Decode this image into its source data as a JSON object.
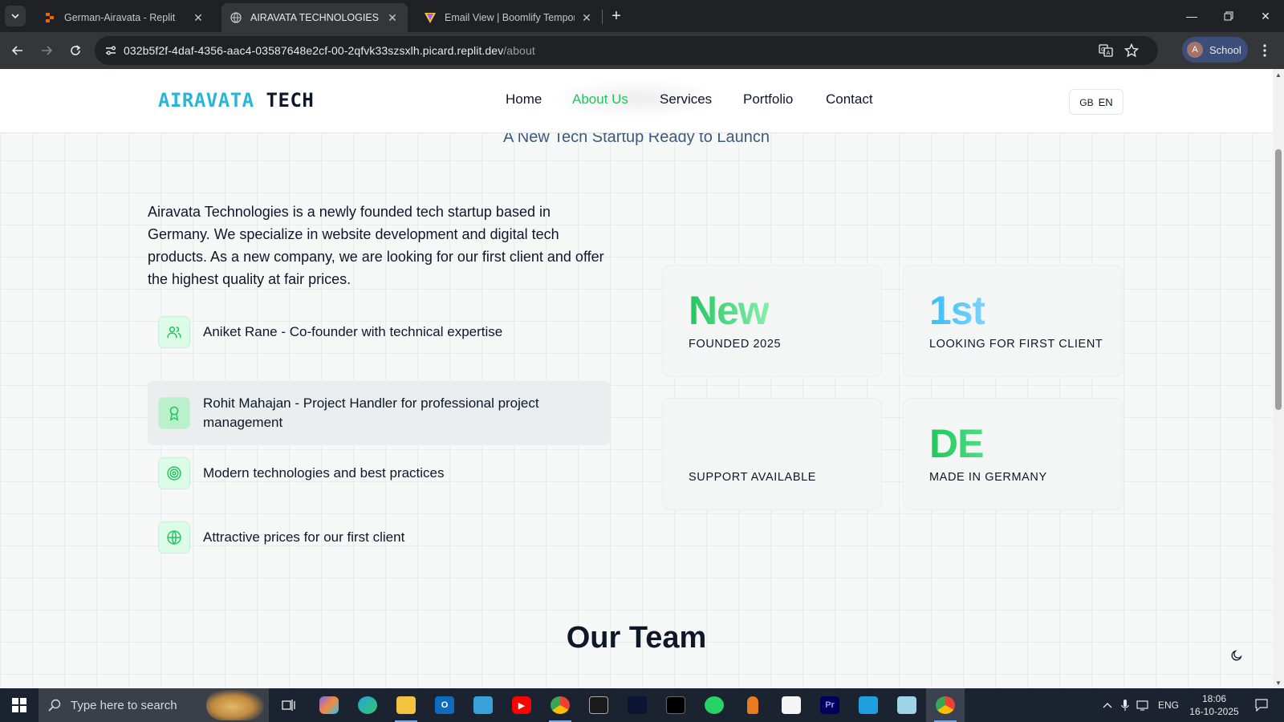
{
  "browser": {
    "tabs": [
      {
        "title": "German-Airavata - Replit",
        "favicon": "replit-icon"
      },
      {
        "title": "AIRAVATA TECHNOLOGIES - Cu",
        "favicon": "globe-icon"
      },
      {
        "title": "Email View | Boomlify Tempora",
        "favicon": "boomlify-icon"
      }
    ],
    "url": {
      "host": "032b5f2f-4daf-4356-aac4-03587648e2cf-00-2qfvk33szsxlh.picard.replit.dev",
      "path": "/about"
    },
    "profile": {
      "initial": "A",
      "label": "School"
    }
  },
  "site": {
    "logo": {
      "part1": "AIRAVATA",
      "part2": "TECH"
    },
    "nav": [
      "Home",
      "About Us",
      "Services",
      "Portfolio",
      "Contact"
    ],
    "active_nav": "About Us",
    "lang": {
      "flag": "GB",
      "code": "EN"
    },
    "subtitle": "A New Tech Startup Ready to Launch",
    "intro": "Airavata Technologies is a newly founded tech startup based in Germany. We specialize in website development and digital tech products. As a new company, we are looking for our first client and offer the highest quality at fair prices.",
    "features": [
      {
        "icon": "users-icon",
        "text": "Aniket Rane - Co-founder with technical expertise"
      },
      {
        "icon": "award-icon",
        "text": "Rohit Mahajan - Project Handler for professional project management"
      },
      {
        "icon": "target-icon",
        "text": "Modern technologies and best practices"
      },
      {
        "icon": "globe-icon",
        "text": "Attractive prices for our first client"
      }
    ],
    "stats": [
      {
        "value": "New",
        "label": "FOUNDED 2025",
        "color": "#4ade80"
      },
      {
        "value": "1st",
        "label": "LOOKING FOR FIRST CLIENT",
        "color": "#38bdf8"
      },
      {
        "value": "",
        "label": "SUPPORT AVAILABLE",
        "color": "#22c55e"
      },
      {
        "value": "DE",
        "label": "MADE IN GERMANY",
        "color": "#22c55e"
      }
    ],
    "team_heading": "Our Team"
  },
  "taskbar": {
    "search_placeholder": "Type here to search",
    "language": "ENG",
    "time": "18:06",
    "date": "16-10-2025"
  },
  "colors": {
    "accent": "#22c55e",
    "logo_blue": "#29b6d6",
    "text": "#0f172a"
  }
}
